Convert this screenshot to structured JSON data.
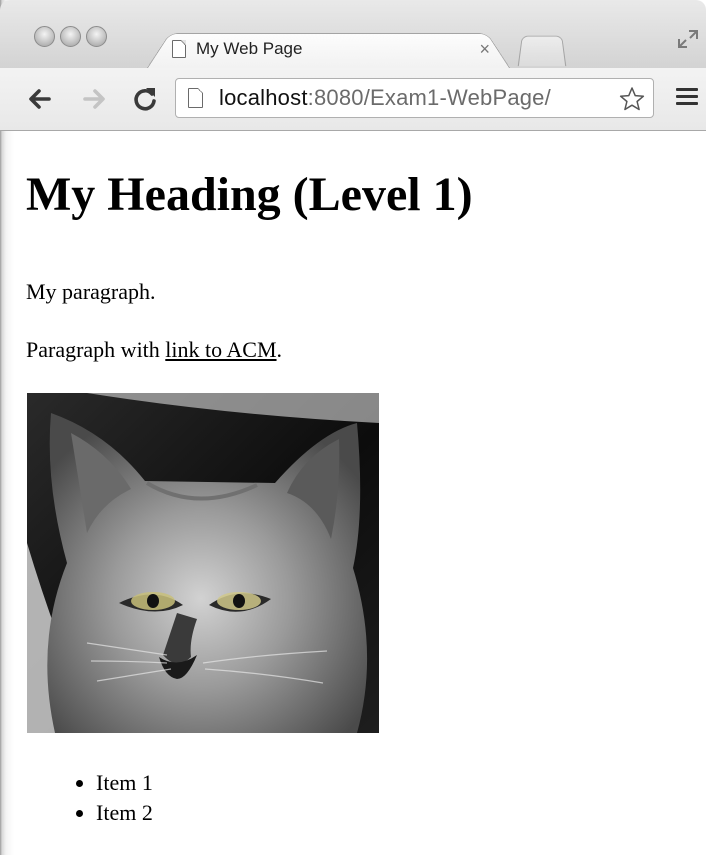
{
  "browser": {
    "tab_title": "My Web Page",
    "tab_close": "×",
    "url_host": "localhost",
    "url_path": ":8080/Exam1-WebPage/",
    "icons": [
      "back-arrow-icon",
      "forward-arrow-icon",
      "reload-icon",
      "page-icon",
      "star-icon",
      "menu-icon",
      "fullscreen-icon",
      "close-icon"
    ]
  },
  "page": {
    "heading": "My Heading (Level 1)",
    "paragraph1": "My paragraph.",
    "paragraph2_prefix": "Paragraph with ",
    "link_text": "link to ACM",
    "paragraph2_suffix": ".",
    "list_items": [
      "Item 1",
      "Item 2"
    ]
  },
  "colors": {
    "chrome_bg": "#e0e0e0",
    "url_host": "#111111",
    "url_path": "#6b6b6b"
  }
}
